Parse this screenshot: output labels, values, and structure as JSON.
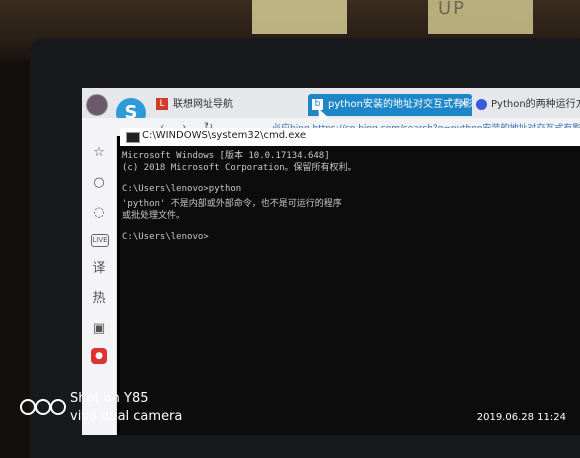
{
  "scene": {
    "note_text": "UP"
  },
  "browser": {
    "tabs": [
      {
        "label": "联想网址导航",
        "favicon": "L"
      },
      {
        "label": "python安装的地址对交互式有影响",
        "favicon": "b"
      },
      {
        "label": "Python的两种运行方式: 交互",
        "favicon": "baidu-icon"
      }
    ],
    "address_text": "必应bing  https://cn.bing.com/search?q=python安装的地址对交互式有影响"
  },
  "cmd": {
    "title": "C:\\WINDOWS\\system32\\cmd.exe",
    "lines": [
      "Microsoft Windows [版本 10.0.17134.648]",
      "(c) 2018 Microsoft Corporation。保留所有权利。",
      "",
      "C:\\Users\\lenovo>python",
      "'python' 不是内部或外部命令，也不是可运行的程序",
      "或批处理文件。",
      "",
      "C:\\Users\\lenovo>"
    ]
  },
  "watermark": {
    "line1": "Shot on Y85",
    "line2": "vivo dual camera",
    "datetime": "2019.06.28 11:24"
  }
}
